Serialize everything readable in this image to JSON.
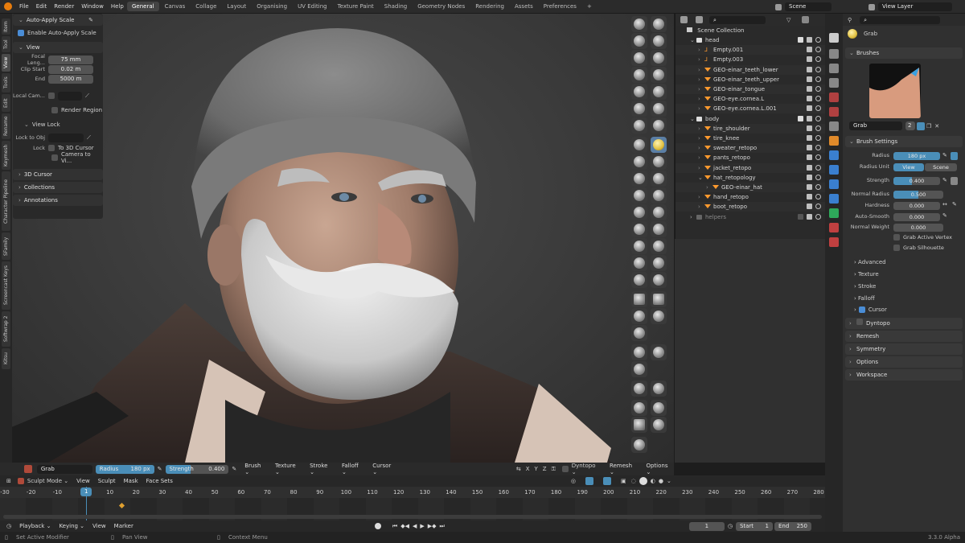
{
  "topbar": {
    "menu": [
      "File",
      "Edit",
      "Render",
      "Window",
      "Help"
    ],
    "workspaces": [
      "General",
      "Canvas",
      "Collage",
      "Layout",
      "Organising",
      "UV Editing",
      "Texture Paint",
      "Shading",
      "Geometry Nodes",
      "Rendering",
      "Assets",
      "Preferences"
    ],
    "active_workspace": "General",
    "scene": "Scene",
    "view_layer": "View Layer"
  },
  "vtabs": [
    "Item",
    "Tool",
    "View",
    "Tools",
    "Edit",
    "Rename",
    "Keymesh",
    "Character Pipeline",
    "SFamily",
    "Screencast Keys",
    "Softwrap 2",
    "Kitsu"
  ],
  "npanel": {
    "auto_apply": {
      "header": "Auto-Apply Scale",
      "option": "Enable Auto-Apply Scale"
    },
    "view": {
      "header": "View",
      "focal_label": "Focal Leng...",
      "focal_value": "75 mm",
      "clip_start_label": "Clip Start",
      "clip_start_value": "0.02 m",
      "end_label": "End",
      "end_value": "5000 m",
      "local_cam_label": "Local Cam...",
      "render_region": "Render Region"
    },
    "view_lock": {
      "header": "View Lock",
      "lock_to_obj": "Lock to Obj",
      "lock_label": "Lock",
      "to_3d_cursor": "To 3D Cursor",
      "camera_to_view": "Camera to Vi..."
    },
    "cursor": "3D Cursor",
    "collections": "Collections",
    "annotations": "Annotations"
  },
  "outliner": {
    "root": "Scene Collection",
    "rows": [
      {
        "label": "head",
        "depth": 1,
        "type": "collection"
      },
      {
        "label": "Empty.001",
        "depth": 2,
        "type": "empty"
      },
      {
        "label": "Empty.003",
        "depth": 2,
        "type": "empty"
      },
      {
        "label": "GEO-einar_teeth_lower",
        "depth": 2,
        "type": "mesh"
      },
      {
        "label": "GEO-einar_teeth_upper",
        "depth": 2,
        "type": "mesh"
      },
      {
        "label": "GEO-einar_tongue",
        "depth": 2,
        "type": "mesh"
      },
      {
        "label": "GEO-eye.cornea.L",
        "depth": 2,
        "type": "mesh"
      },
      {
        "label": "GEO-eye.cornea.L.001",
        "depth": 2,
        "type": "mesh"
      },
      {
        "label": "body",
        "depth": 1,
        "type": "collection"
      },
      {
        "label": "tire_shoulder",
        "depth": 2,
        "type": "mesh"
      },
      {
        "label": "tire_knee",
        "depth": 2,
        "type": "mesh"
      },
      {
        "label": "sweater_retopo",
        "depth": 2,
        "type": "mesh"
      },
      {
        "label": "pants_retopo",
        "depth": 2,
        "type": "mesh"
      },
      {
        "label": "jacket_retopo",
        "depth": 2,
        "type": "mesh"
      },
      {
        "label": "hat_retopology",
        "depth": 2,
        "type": "mesh"
      },
      {
        "label": "GEO-einar_hat",
        "depth": 3,
        "type": "mesh"
      },
      {
        "label": "hand_retopo",
        "depth": 2,
        "type": "mesh"
      },
      {
        "label": "boot_retopo",
        "depth": 2,
        "type": "mesh"
      },
      {
        "label": "helpers",
        "depth": 1,
        "type": "collection"
      }
    ]
  },
  "props": {
    "tool_name": "Grab",
    "brushes_header": "Brushes",
    "brush_name": "Grab",
    "brush_users": "2",
    "brush_settings_header": "Brush Settings",
    "radius_label": "Radius",
    "radius_value": "180 px",
    "radius_unit_label": "Radius Unit",
    "unit_view": "View",
    "unit_scene": "Scene",
    "strength_label": "Strength",
    "strength_value": "0.400",
    "strength_fraction": 0.4,
    "normal_radius_label": "Normal Radius",
    "normal_radius_value": "0.500",
    "normal_radius_fraction": 0.5,
    "hardness_label": "Hardness",
    "hardness_value": "0.000",
    "auto_smooth_label": "Auto-Smooth",
    "auto_smooth_value": "0.000",
    "normal_weight_label": "Normal Weight",
    "normal_weight_value": "0.000",
    "grab_active_vertex": "Grab Active Vertex",
    "grab_silhouette": "Grab Silhouette",
    "subpanels": [
      "Advanced",
      "Texture",
      "Stroke",
      "Falloff",
      "Cursor"
    ],
    "sections": [
      "Dyntopo",
      "Remesh",
      "Symmetry",
      "Options",
      "Workspace"
    ]
  },
  "header3d": {
    "brush": "Grab",
    "radius_label": "Radius",
    "radius_value": "180 px",
    "strength_label": "Strength",
    "strength_value": "0.400",
    "menus": [
      "Brush",
      "Texture",
      "Stroke",
      "Falloff",
      "Cursor"
    ],
    "axes": [
      "X",
      "Y",
      "Z"
    ],
    "right_menus": [
      "Dyntopo",
      "Remesh",
      "Options"
    ]
  },
  "modebar": {
    "mode": "Sculpt Mode",
    "menus": [
      "View",
      "Sculpt",
      "Mask",
      "Face Sets"
    ]
  },
  "timeline": {
    "ticks": [
      "-30",
      "-20",
      "-10",
      "1",
      "10",
      "20",
      "30",
      "40",
      "50",
      "60",
      "70",
      "80",
      "90",
      "100",
      "110",
      "120",
      "130",
      "140",
      "150",
      "160",
      "170",
      "180",
      "190",
      "200",
      "210",
      "220",
      "230",
      "240",
      "250",
      "260",
      "270",
      "280"
    ],
    "current_frame": "1",
    "frame_field": "1",
    "start_label": "Start",
    "start_value": "1",
    "end_label": "End",
    "end_value": "250"
  },
  "playbar": {
    "menus": [
      "Playback",
      "Keying",
      "View",
      "Marker"
    ]
  },
  "statusbar": {
    "left": "Set Active Modifier",
    "middle": "Pan View",
    "right": "Context Menu",
    "version": "3.3.0 Alpha"
  },
  "colors": {
    "accent_blue": "#4a8eb8",
    "mesh_orange": "#ff9a2e",
    "selected_tool": "#5b7fa5"
  }
}
